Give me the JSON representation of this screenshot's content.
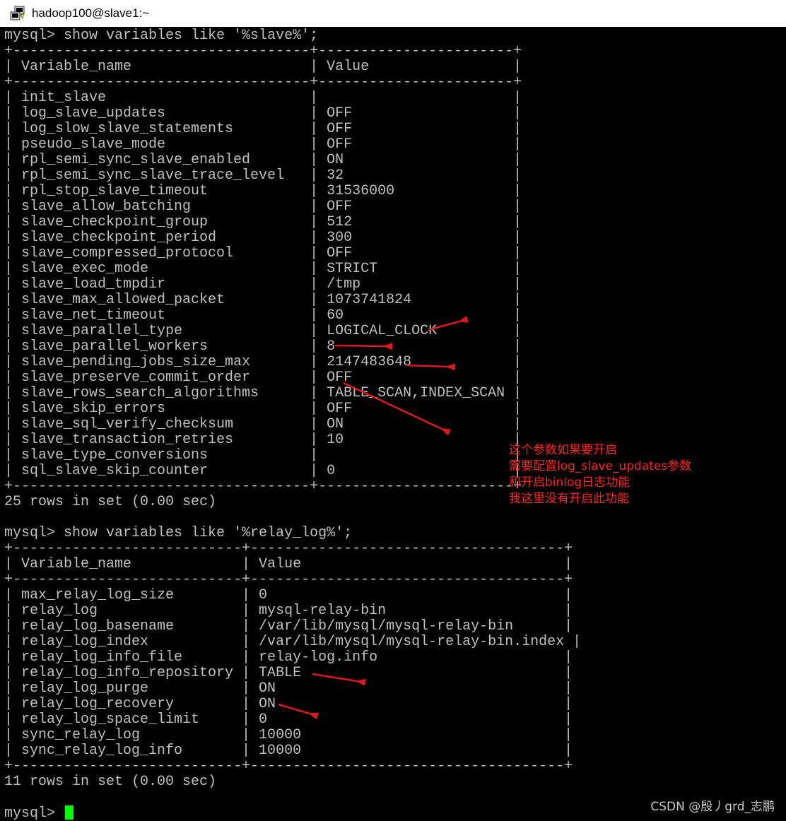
{
  "window": {
    "title": "hadoop100@slave1:~",
    "icon": "putty-terminal-icon"
  },
  "terminal": {
    "lines": [
      "mysql> show variables like '%slave%';",
      "+-----------------------------------+-----------------------+",
      "| Variable_name                     | Value                 |",
      "+-----------------------------------+-----------------------+",
      "| init_slave                        |                       |",
      "| log_slave_updates                 | OFF                   |",
      "| log_slow_slave_statements         | OFF                   |",
      "| pseudo_slave_mode                 | OFF                   |",
      "| rpl_semi_sync_slave_enabled       | ON                    |",
      "| rpl_semi_sync_slave_trace_level   | 32                    |",
      "| rpl_stop_slave_timeout            | 31536000              |",
      "| slave_allow_batching              | OFF                   |",
      "| slave_checkpoint_group            | 512                   |",
      "| slave_checkpoint_period           | 300                   |",
      "| slave_compressed_protocol         | OFF                   |",
      "| slave_exec_mode                   | STRICT                |",
      "| slave_load_tmpdir                 | /tmp                  |",
      "| slave_max_allowed_packet          | 1073741824            |",
      "| slave_net_timeout                 | 60                    |",
      "| slave_parallel_type               | LOGICAL_CLOCK         |",
      "| slave_parallel_workers            | 8                     |",
      "| slave_pending_jobs_size_max       | 2147483648            |",
      "| slave_preserve_commit_order       | OFF                   |",
      "| slave_rows_search_algorithms      | TABLE_SCAN,INDEX_SCAN |",
      "| slave_skip_errors                 | OFF                   |",
      "| slave_sql_verify_checksum         | ON                    |",
      "| slave_transaction_retries         | 10                    |",
      "| slave_type_conversions            |                       |",
      "| sql_slave_skip_counter            | 0                     |",
      "+-----------------------------------+-----------------------+",
      "25 rows in set (0.00 sec)",
      "",
      "mysql> show variables like '%relay_log%';",
      "+---------------------------+-------------------------------------+",
      "| Variable_name             | Value                               |",
      "+---------------------------+-------------------------------------+",
      "| max_relay_log_size        | 0                                   |",
      "| relay_log                 | mysql-relay-bin                     |",
      "| relay_log_basename        | /var/lib/mysql/mysql-relay-bin      |",
      "| relay_log_index           | /var/lib/mysql/mysql-relay-bin.index |",
      "| relay_log_info_file       | relay-log.info                      |",
      "| relay_log_info_repository | TABLE                               |",
      "| relay_log_purge           | ON                                  |",
      "| relay_log_recovery        | ON                                  |",
      "| relay_log_space_limit     | 0                                   |",
      "| sync_relay_log            | 10000                               |",
      "| sync_relay_log_info       | 10000                               |",
      "+---------------------------+-------------------------------------+",
      "11 rows in set (0.00 sec)",
      ""
    ],
    "prompt": "mysql> "
  },
  "annotation": {
    "lines": [
      "这个参数如果要开启",
      "需要配置log_slave_updates参数",
      "和开启binlog日志功能",
      "我这里没有开启此功能"
    ],
    "color": "#ff2020"
  },
  "watermark": "CSDN @殷丿grd_志鹏",
  "colors": {
    "terminal_bg": "#000000",
    "terminal_fg": "#c0c0c0",
    "cursor": "#00ff00",
    "arrow": "#e01818"
  }
}
